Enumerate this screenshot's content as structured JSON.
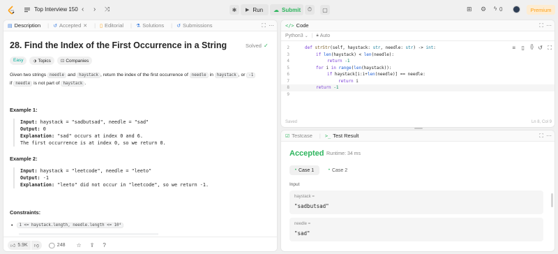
{
  "topbar": {
    "list_title": "Top Interview 150",
    "run_label": "Run",
    "submit_label": "Submit",
    "streak_count": "0",
    "premium_label": "Premium"
  },
  "left_tabs": [
    {
      "label": "Description"
    },
    {
      "label": "Accepted"
    },
    {
      "label": "Editorial"
    },
    {
      "label": "Solutions"
    },
    {
      "label": "Submissions"
    }
  ],
  "problem": {
    "title": "28. Find the Index of the First Occurrence in a String",
    "status": "Solved",
    "difficulty": "Easy",
    "topics_label": "Topics",
    "companies_label": "Companies",
    "desc": {
      "p1": "Given two strings ",
      "c1": "needle",
      "p2": " and ",
      "c2": "haystack",
      "p3": ", return the index of the first occurrence of ",
      "c3": "needle",
      "p4": " in ",
      "c4": "haystack",
      "p5": ", or ",
      "c5": "-1",
      "p6": "if ",
      "c6": "needle",
      "p7": " is not part of ",
      "c7": "haystack",
      "p8": "."
    },
    "examples": [
      {
        "heading": "Example 1:",
        "input_label": "Input:",
        "input": " haystack = \"sadbutsad\", needle = \"sad\"",
        "output_label": "Output:",
        "output": " 0",
        "expl_label": "Explanation:",
        "expl": " \"sad\" occurs at index 0 and 6.",
        "expl2": "The first occurrence is at index 0, so we return 0."
      },
      {
        "heading": "Example 2:",
        "input_label": "Input:",
        "input": " haystack = \"leetcode\", needle = \"leeto\"",
        "output_label": "Output:",
        "output": " -1",
        "expl_label": "Explanation:",
        "expl": " \"leeto\" did not occur in \"leetcode\", so we return -1."
      }
    ],
    "constraints_heading": "Constraints:",
    "constraint_1": "1 <= haystack.length, needle.length <= 10⁴"
  },
  "bottom_bar": {
    "likes": "5.9K",
    "comments": "248"
  },
  "code": {
    "tab_label": "Code",
    "language": "Python3",
    "mode": "Auto",
    "status_left": "Saved",
    "status_right": "Ln 8, Col 9",
    "line_numbers": [
      "2",
      "3",
      "4",
      "5",
      "6",
      "7",
      "8",
      "9"
    ]
  },
  "result": {
    "tab_testcase": "Testcase",
    "tab_result": "Test Result",
    "status": "Accepted",
    "runtime": "Runtime: 34 ms",
    "case1": "Case 1",
    "case2": "Case 2",
    "input_heading": "Input",
    "var1_name": "haystack =",
    "var1_value": "\"sadbutsad\"",
    "var2_name": "needle =",
    "var2_value": "\"sad\""
  },
  "colors": {
    "accent_green": "#2db55d",
    "accent_orange": "#ffa116",
    "easy_teal": "#00af9b",
    "link_blue": "#3a7ee0"
  }
}
